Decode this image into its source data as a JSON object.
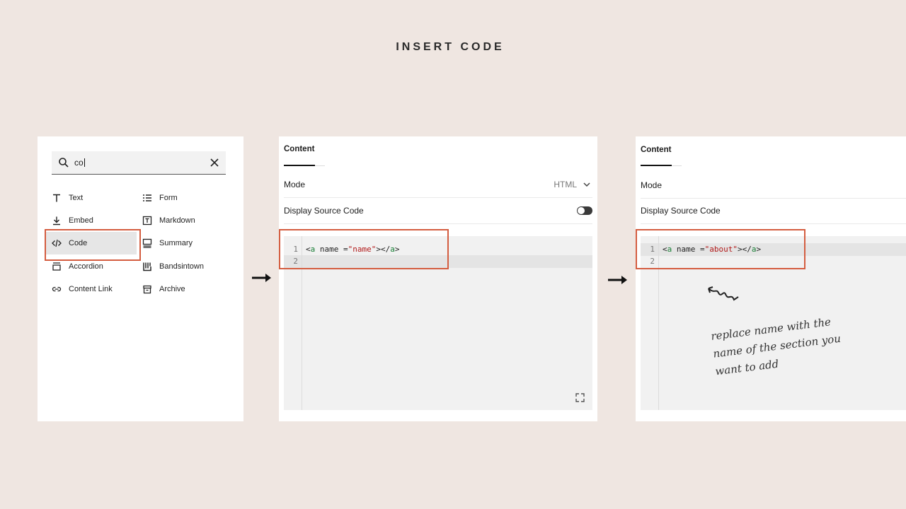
{
  "title": "INSERT CODE",
  "search": {
    "value": "co"
  },
  "blocks": [
    {
      "label": "Text",
      "icon": "text-icon"
    },
    {
      "label": "Form",
      "icon": "form-icon"
    },
    {
      "label": "Embed",
      "icon": "embed-icon"
    },
    {
      "label": "Markdown",
      "icon": "markdown-icon"
    },
    {
      "label": "Code",
      "icon": "code-icon",
      "selected": true
    },
    {
      "label": "Summary",
      "icon": "summary-icon"
    },
    {
      "label": "Accordion",
      "icon": "accordion-icon"
    },
    {
      "label": "Bandsintown",
      "icon": "bandsintown-icon"
    },
    {
      "label": "Content Link",
      "icon": "link-icon"
    },
    {
      "label": "Archive",
      "icon": "archive-icon"
    }
  ],
  "editor1": {
    "tab": "Content",
    "mode_label": "Mode",
    "mode_value": "HTML",
    "source_label": "Display Source Code",
    "line_numbers": [
      "1",
      "2"
    ],
    "code_open": "<",
    "code_tag": "a",
    "code_attr": " name =",
    "code_value": "\"name\"",
    "code_close": "></",
    "code_tag2": "a",
    "code_end": ">"
  },
  "editor2": {
    "tab": "Content",
    "mode_label": "Mode",
    "source_label": "Display Source Code",
    "line_numbers": [
      "1",
      "2"
    ],
    "code_open": "<",
    "code_tag": "a",
    "code_attr": " name =",
    "code_value": "\"about\"",
    "code_close": "></",
    "code_tag2": "a",
    "code_end": ">"
  },
  "note": "replace name with the\nname of the section you\nwant to add",
  "colors": {
    "background": "#efe6e1",
    "highlight": "#d45d40",
    "tag": "#1a7f37",
    "string": "#b21a1a"
  }
}
